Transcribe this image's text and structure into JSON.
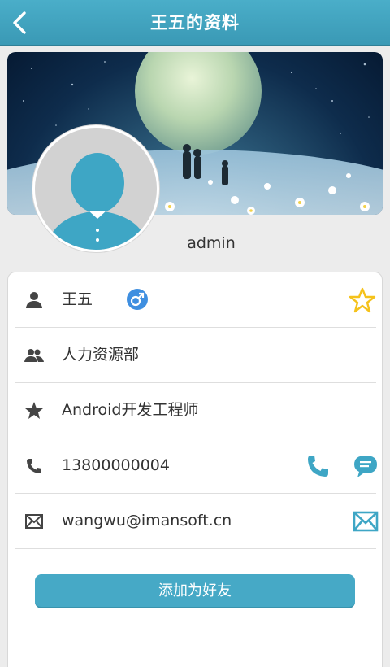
{
  "header": {
    "title": "王五的资料",
    "back_icon": "chevron-left-icon"
  },
  "profile": {
    "username": "admin"
  },
  "details": [
    {
      "icon": "person-icon",
      "value": "王五",
      "badge_icon": "male-icon",
      "action_icon": "star-outline-icon"
    },
    {
      "icon": "group-icon",
      "value": "人力资源部"
    },
    {
      "icon": "star-icon",
      "value": "Android开发工程师"
    },
    {
      "icon": "phone-icon",
      "value": "13800000004",
      "action_icons": [
        "call-icon",
        "message-icon"
      ]
    },
    {
      "icon": "mail-icon",
      "value": "wangwu@imansoft.cn",
      "action_icon": "send-mail-icon"
    }
  ],
  "actions": {
    "add_friend_label": "添加为好友"
  },
  "colors": {
    "accent": "#46a9c6",
    "header": "#3a99b5",
    "star": "#f5c21b",
    "male": "#3f8fe0"
  }
}
